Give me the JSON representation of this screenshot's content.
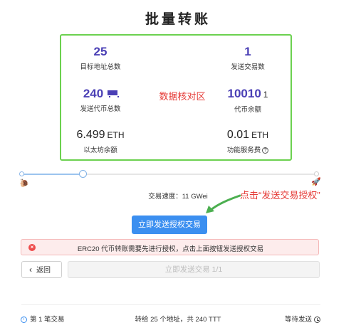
{
  "page_title": "批量转账",
  "summary": {
    "target_count": {
      "value": "25",
      "label": "目标地址总数"
    },
    "tx_count": {
      "value": "1",
      "label": "发送交易数"
    },
    "token_total": {
      "value": "240",
      "label": "发送代币总数"
    },
    "token_balance": {
      "value": "10010",
      "suffix": "1",
      "label": "代币余额"
    },
    "eth_balance": {
      "value": "6.499",
      "unit": "ETH",
      "label": "以太坊余额"
    },
    "service_fee": {
      "value": "0.01",
      "unit": "ETH",
      "label": "功能服务费"
    }
  },
  "annotations": {
    "center": "数据核对区",
    "right": "点击“发送交易授权”",
    "color": "#e53935"
  },
  "gas": {
    "speed_label": "交易速度：11 GWei",
    "slider_level_percent": 21
  },
  "buttons": {
    "authorize": "立即发送授权交易",
    "back": "返回",
    "send": "立即发送交易 1/1"
  },
  "alert": {
    "message": "ERC20 代币转账需要先进行授权，点击上面按钮发送授权交易"
  },
  "footer": {
    "left": "第 1 笔交易",
    "middle": "转给 25 个地址，共 240 TTT",
    "right": "等待发送"
  },
  "icons": {
    "slow": "snail-icon",
    "fast": "rocket-icon",
    "error": "close-circle-icon",
    "back": "chevron-left-icon",
    "info": "info-icon",
    "clock": "clock-icon",
    "help": "question-icon"
  },
  "colors": {
    "accent": "#3b8ff0",
    "value": "#4a3fb5",
    "panel_border": "#6bd14f"
  }
}
